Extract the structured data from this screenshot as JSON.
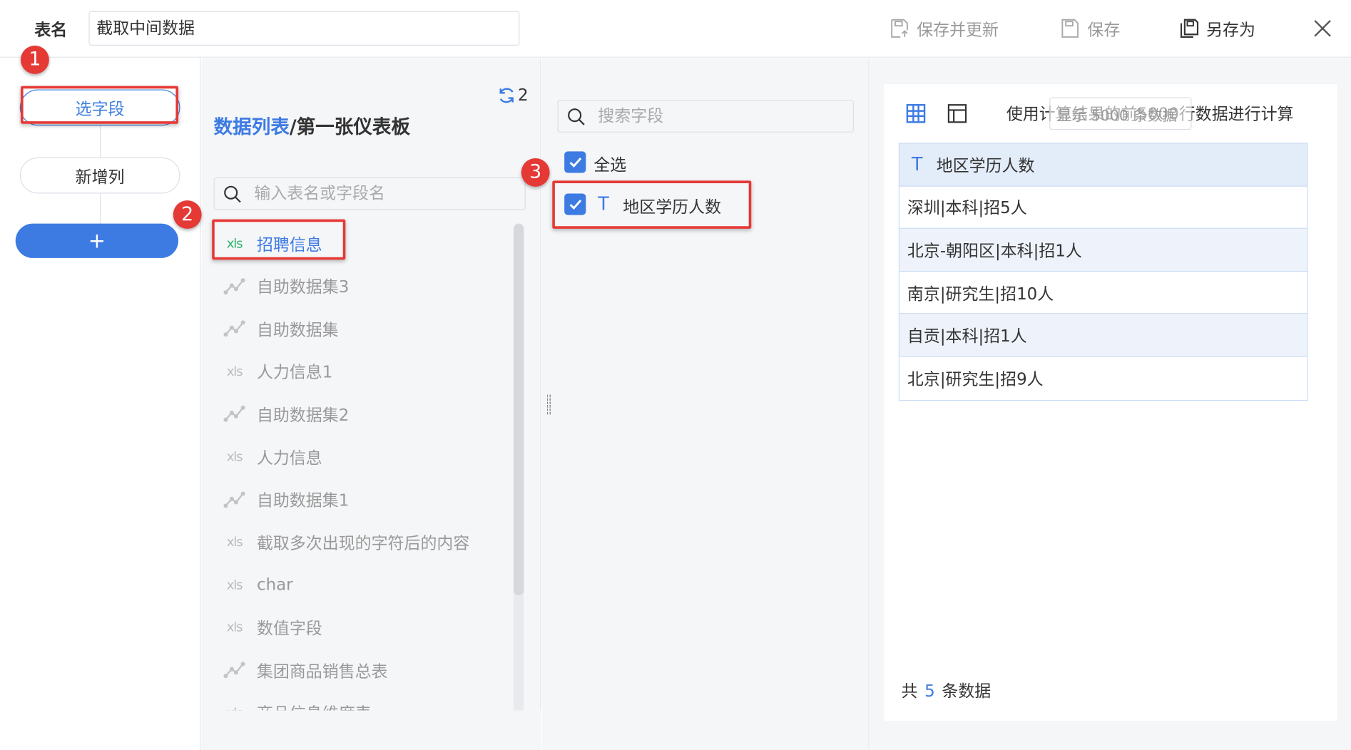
{
  "header": {
    "table_name_label": "表名",
    "table_name_value": "截取中间数据",
    "save_update_label": "保存并更新",
    "save_label": "保存",
    "save_as_label": "另存为"
  },
  "steps": {
    "select_fields": "选字段",
    "add_column": "新增列",
    "add_button": "+"
  },
  "datasource": {
    "refresh_count": "2",
    "breadcrumb_link": "数据列表",
    "breadcrumb_sep": "/",
    "breadcrumb_current": "第一张仪表板",
    "search_placeholder": "输入表名或字段名",
    "items": [
      {
        "label": "招聘信息",
        "icon": "xls-icon",
        "selected": true
      },
      {
        "label": "自助数据集3",
        "icon": "dataset-icon"
      },
      {
        "label": "自助数据集",
        "icon": "dataset-icon"
      },
      {
        "label": "人力信息1",
        "icon": "xls-icon"
      },
      {
        "label": "自助数据集2",
        "icon": "dataset-icon"
      },
      {
        "label": "人力信息",
        "icon": "xls-icon"
      },
      {
        "label": "自助数据集1",
        "icon": "dataset-icon"
      },
      {
        "label": "截取多次出现的字符后的内容",
        "icon": "xls-icon"
      },
      {
        "label": "char",
        "icon": "xls-icon"
      },
      {
        "label": "数值字段",
        "icon": "xls-icon"
      },
      {
        "label": "集团商品销售总表",
        "icon": "dataset-icon"
      },
      {
        "label": "商品信息维度表",
        "icon": "xls-icon"
      }
    ],
    "xls_glyph": "xls"
  },
  "fields": {
    "search_placeholder": "搜索字段",
    "select_all": "全选",
    "items": [
      {
        "label": "地区学历人数",
        "type_glyph": "T",
        "checked": true
      }
    ]
  },
  "preview": {
    "notice": "使用计算结果的前5000行数据进行计算",
    "limit_overlay": "显示  5000  条数据",
    "column_header": "地区学历人数",
    "column_type_glyph": "T",
    "rows": [
      "深圳|本科|招5人",
      "北京-朝阳区|本科|招1人",
      "南京|研究生|招10人",
      "自贡|本科|招1人",
      "北京|研究生|招9人"
    ],
    "count_prefix": "共",
    "count_value": "5",
    "count_suffix": "条数据"
  },
  "annotations": [
    "1",
    "2",
    "3"
  ],
  "colors": {
    "accent": "#3d7be3",
    "annotation_red": "#e53935",
    "xls_green": "#2ab36b"
  }
}
